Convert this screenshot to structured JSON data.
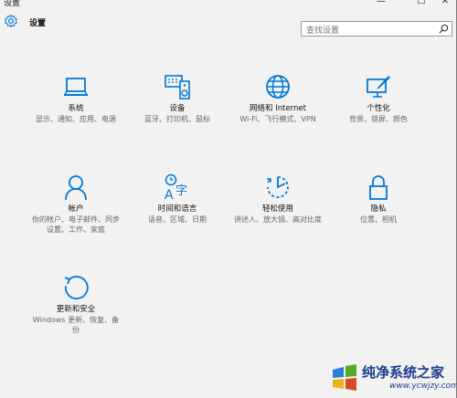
{
  "window": {
    "title": "设置",
    "min": "—",
    "max": "☐",
    "close": "✕"
  },
  "header": {
    "title": "设置"
  },
  "search": {
    "placeholder": "查找设置"
  },
  "tiles": [
    {
      "title": "系统",
      "desc": "显示、通知、应用、电源",
      "icon": "laptop-icon"
    },
    {
      "title": "设备",
      "desc": "蓝牙、打印机、鼠标",
      "icon": "devices-icon"
    },
    {
      "title": "网络和 Internet",
      "desc": "Wi-Fi、飞行模式、VPN",
      "icon": "globe-icon"
    },
    {
      "title": "个性化",
      "desc": "背景、锁屏、颜色",
      "icon": "paint-icon"
    },
    {
      "title": "帐户",
      "desc": "你的帐户、电子邮件、同步设置、工作、家庭",
      "icon": "person-icon"
    },
    {
      "title": "时间和语言",
      "desc": "语音、区域、日期",
      "icon": "time-language-icon"
    },
    {
      "title": "轻松使用",
      "desc": "讲述人、放大镜、高对比度",
      "icon": "ease-of-access-icon"
    },
    {
      "title": "隐私",
      "desc": "位置、相机",
      "icon": "lock-icon"
    },
    {
      "title": "更新和安全",
      "desc": "Windows 更新、恢复、备份",
      "icon": "update-icon"
    }
  ],
  "watermark": {
    "text": "纯净系统之家",
    "url": "www.ycwjzy.com"
  },
  "colors": {
    "accent": "#0078d7",
    "background": "#f2f2f2"
  }
}
